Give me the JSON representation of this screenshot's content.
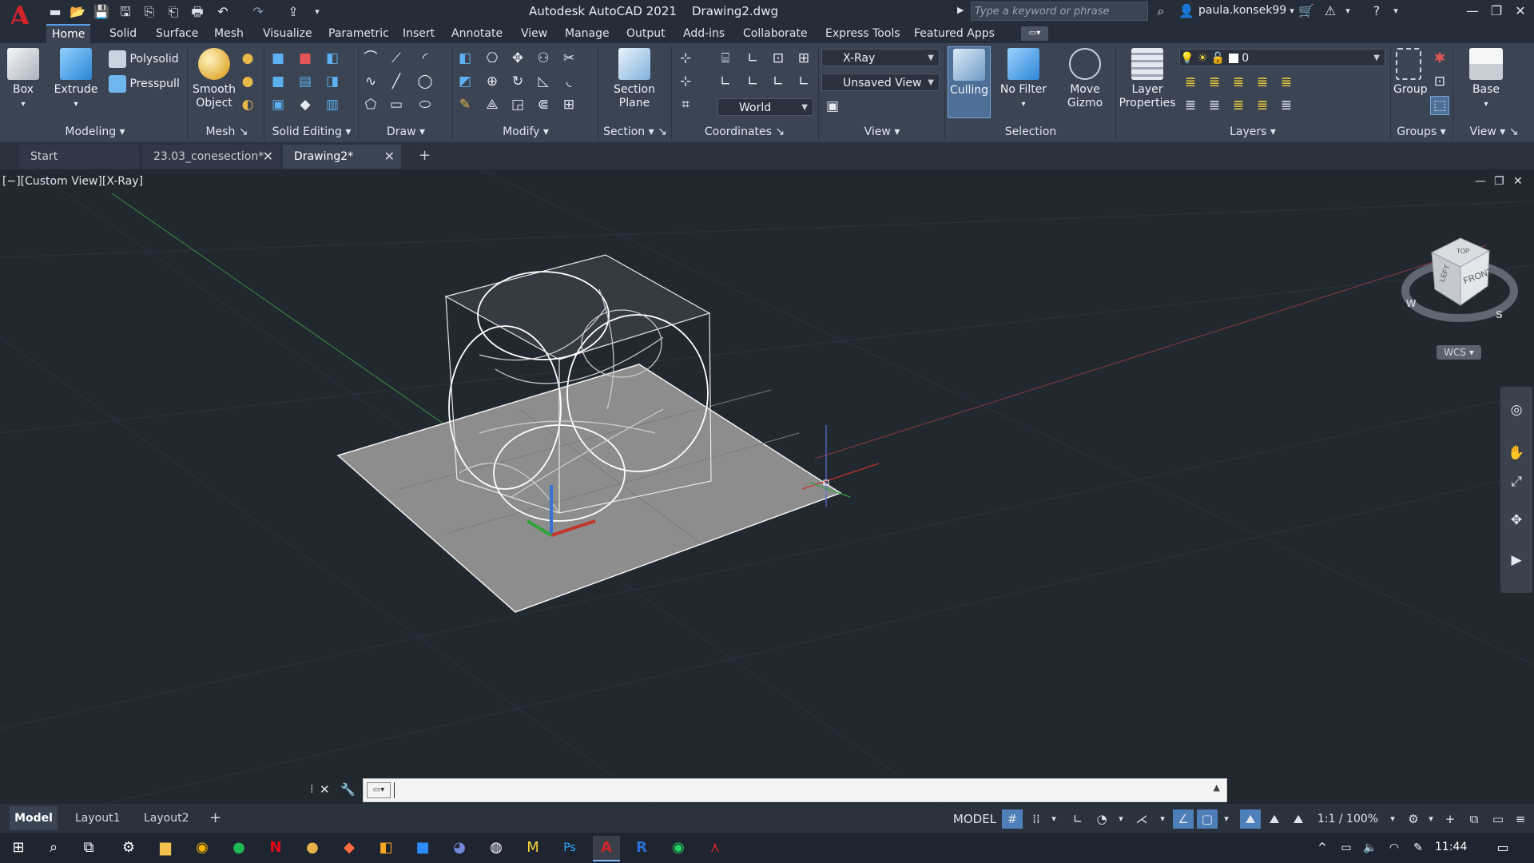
{
  "titlebar": {
    "app_name": "Autodesk AutoCAD 2021",
    "file_name": "Drawing2.dwg",
    "search_placeholder": "Type a keyword or phrase",
    "user": "paula.konsek99"
  },
  "ribbon_tabs": [
    "Home",
    "Solid",
    "Surface",
    "Mesh",
    "Visualize",
    "Parametric",
    "Insert",
    "Annotate",
    "View",
    "Manage",
    "Output",
    "Add-ins",
    "Collaborate",
    "Express Tools",
    "Featured Apps"
  ],
  "modeling": {
    "box_label": "Box",
    "extrude_label": "Extrude",
    "polysolid_label": "Polysolid",
    "presspull_label": "Presspull",
    "title": "Modeling"
  },
  "mesh": {
    "smooth_label_1": "Smooth",
    "smooth_label_2": "Object",
    "title": "Mesh"
  },
  "solid_editing": {
    "title": "Solid Editing"
  },
  "draw": {
    "title": "Draw"
  },
  "modify": {
    "title": "Modify"
  },
  "section": {
    "label_1": "Section",
    "label_2": "Plane",
    "title": "Section"
  },
  "coordinates": {
    "world_value": "World",
    "title": "Coordinates"
  },
  "view_panel": {
    "visual_style_value": "X-Ray",
    "named_view_value": "Unsaved View",
    "title": "View"
  },
  "selection": {
    "culling_label": "Culling",
    "nofilter_label": "No Filter",
    "gizmo_label_1": "Move",
    "gizmo_label_2": "Gizmo",
    "title": "Selection"
  },
  "layers": {
    "props_label_1": "Layer",
    "props_label_2": "Properties",
    "current_layer": "0",
    "title": "Layers"
  },
  "groups": {
    "group_label": "Group",
    "title": "Groups"
  },
  "view_right": {
    "base_label": "Base",
    "title": "View"
  },
  "doc_tabs": {
    "start": "Start",
    "tab1": "23.03_conesection*",
    "tab2": "Drawing2*"
  },
  "viewport": {
    "label": "[−][Custom View][X-Ray]"
  },
  "viewcube": {
    "top": "TOP",
    "left": "LEFT",
    "front": "FRONT",
    "compass_w": "W",
    "compass_s": "S",
    "wcs": "WCS"
  },
  "layout_tabs": [
    "Model",
    "Layout1",
    "Layout2"
  ],
  "status": {
    "model": "MODEL",
    "scale": "1:1 / 100%"
  },
  "taskbar": {
    "time": "11:44"
  }
}
